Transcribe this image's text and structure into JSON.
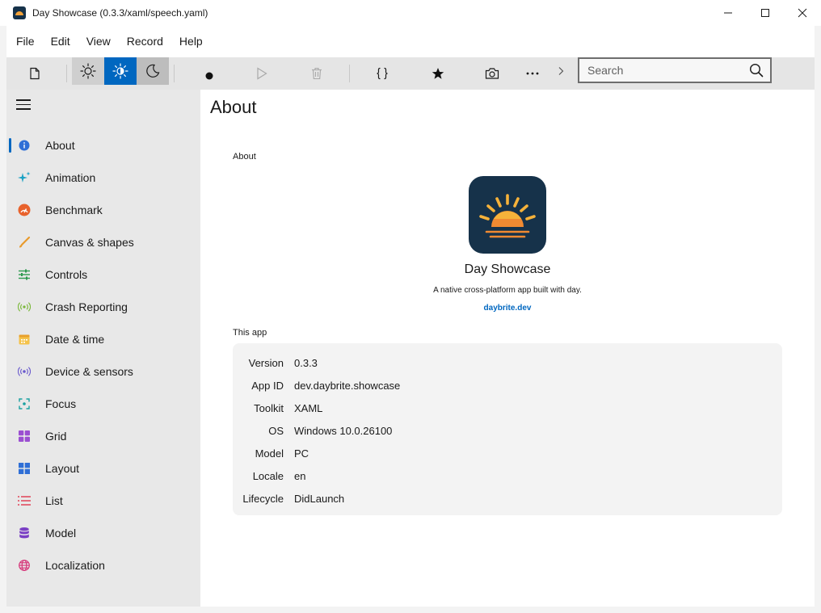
{
  "window": {
    "title": "Day Showcase (0.3.3/xaml/speech.yaml)"
  },
  "menu": [
    "File",
    "Edit",
    "View",
    "Record",
    "Help"
  ],
  "toolbar": {
    "search_placeholder": "Search"
  },
  "sidebar": {
    "items": [
      {
        "label": "About",
        "icon": "info-icon",
        "color": "#2f6fd6"
      },
      {
        "label": "Animation",
        "icon": "sparkle-icon",
        "color": "#1aa1c4"
      },
      {
        "label": "Benchmark",
        "icon": "speedometer-icon",
        "color": "#e8622c"
      },
      {
        "label": "Canvas & shapes",
        "icon": "brush-icon",
        "color": "#e89a2c"
      },
      {
        "label": "Controls",
        "icon": "sliders-icon",
        "color": "#2e9a4e"
      },
      {
        "label": "Crash Reporting",
        "icon": "broadcast-icon",
        "color": "#7ab83a"
      },
      {
        "label": "Date & time",
        "icon": "calendar-icon",
        "color": "#e8b42c"
      },
      {
        "label": "Device & sensors",
        "icon": "sensor-icon",
        "color": "#6a5acd"
      },
      {
        "label": "Focus",
        "icon": "focus-icon",
        "color": "#1aa1a1"
      },
      {
        "label": "Grid",
        "icon": "grid-icon",
        "color": "#9b4fd1"
      },
      {
        "label": "Layout",
        "icon": "layout-icon",
        "color": "#2f6fd6"
      },
      {
        "label": "List",
        "icon": "list-icon",
        "color": "#e0364c"
      },
      {
        "label": "Model",
        "icon": "database-icon",
        "color": "#7a3fc4"
      },
      {
        "label": "Localization",
        "icon": "globe-icon",
        "color": "#d6367a"
      }
    ]
  },
  "main": {
    "title": "About",
    "section_about": "About",
    "app_name": "Day Showcase",
    "tagline": "A native cross-platform app built with day.",
    "link": "daybrite.dev",
    "section_app": "This app",
    "info": [
      {
        "key": "Version",
        "value": "0.3.3"
      },
      {
        "key": "App ID",
        "value": "dev.daybrite.showcase"
      },
      {
        "key": "Toolkit",
        "value": "XAML"
      },
      {
        "key": "OS",
        "value": "Windows 10.0.26100"
      },
      {
        "key": "Model",
        "value": "PC"
      },
      {
        "key": "Locale",
        "value": "en"
      },
      {
        "key": "Lifecycle",
        "value": "DidLaunch"
      }
    ]
  },
  "colors": {
    "accent": "#0067c0",
    "logo_bg": "#16324a",
    "sun": "#f6b23a"
  }
}
